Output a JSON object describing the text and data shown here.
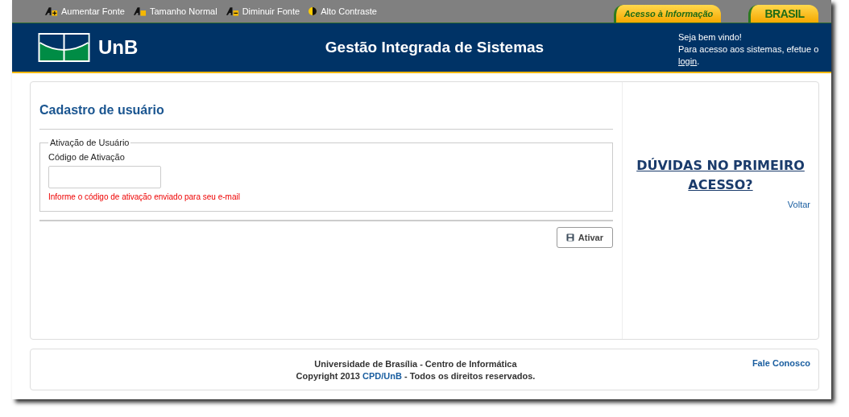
{
  "accessibility_bar": [
    {
      "kind": "increase",
      "label": "Aumentar Fonte"
    },
    {
      "kind": "normal",
      "label": "Tamanho Normal"
    },
    {
      "kind": "decrease",
      "label": "Diminuir Fonte"
    },
    {
      "kind": "contrast",
      "label": "Alto Contraste"
    }
  ],
  "top_badges": [
    {
      "kind": "info",
      "label": "Acesso à Informação"
    },
    {
      "kind": "brasil",
      "label": "BRASIL"
    }
  ],
  "header": {
    "logo_text": "UnB",
    "title": "Gestão Integrada de Sistemas",
    "welcome": "Seja bem vindo!",
    "login_prefix": "Para acesso aos sistemas, efetue o",
    "login_link": "login",
    "login_suffix": "."
  },
  "form": {
    "title": "Cadastro de usuário",
    "fieldset_legend": "Ativação de Usuário",
    "field_label": "Código de Ativação",
    "hint": "Informe o código de ativação enviado para seu e-mail",
    "submit": "Ativar"
  },
  "sidebar": {
    "help_link": "DÚVIDAS NO PRIMEIRO ACESSO?",
    "back_link": "Voltar"
  },
  "footer": {
    "line_1": "Universidade de Brasília - Centro de Informática",
    "copyright_prefix": "Copyright 2013",
    "copyright_link": "CPD/UnB",
    "copyright_suffix": "- Todos os direitos reservados.",
    "contact_link": "Fale Conosco"
  }
}
